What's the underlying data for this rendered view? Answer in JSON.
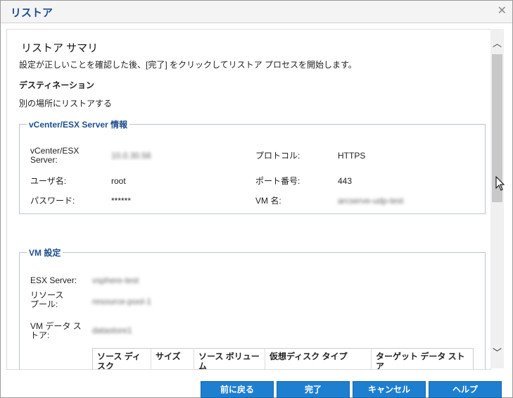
{
  "window": {
    "title": "リストア",
    "close_glyph": "✕"
  },
  "summary": {
    "heading": "リストア サマリ",
    "description": "設定が正しいことを確認した後、[完了] をクリックしてリストア プロセスを開始します。",
    "destination_heading": "デスティネーション",
    "destination_value": "別の場所にリストアする"
  },
  "vcenter": {
    "legend": "vCenter/ESX Server 情報",
    "server_label": "vCenter/ESX Server:",
    "server_value": "10.0.30.56",
    "protocol_label": "プロトコル:",
    "protocol_value": "HTTPS",
    "user_label": "ユーザ名:",
    "user_value": "root",
    "port_label": "ポート番号:",
    "port_value": "443",
    "password_label": "パスワード:",
    "password_value": "******",
    "vmname_label": "VM 名:",
    "vmname_value": "arcserve-udp-test"
  },
  "vm": {
    "legend": "VM 設定",
    "esx_label": "ESX Server:",
    "esx_value": "vsphere-test",
    "pool_label": "リソース プール:",
    "pool_value": "resource-pool-1",
    "datastore_label": "VM データ ストア:",
    "datastore_value": "datastore1",
    "disk_table": {
      "headers": [
        "ソース ディスク",
        "サイズ",
        "ソース ボリューム",
        "仮想ディスク タイプ",
        "ターゲット データ ストア"
      ]
    }
  },
  "footer": {
    "back": "前に戻る",
    "finish": "完了",
    "cancel": "キャンセル",
    "help": "ヘルプ"
  },
  "scrollbar": {
    "up_glyph": "︿",
    "down_glyph": "﹀"
  },
  "colors": {
    "accent": "#1c4f8f",
    "button": "#1e7fd0"
  },
  "icons": {
    "close": "close-icon",
    "cursor": "mouse-pointer-icon"
  }
}
